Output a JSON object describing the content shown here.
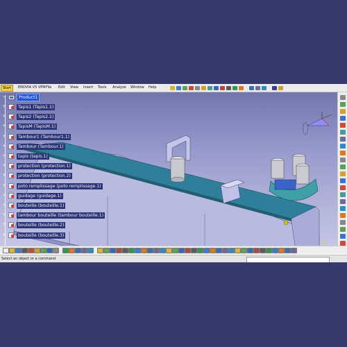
{
  "menubar": {
    "start_label": "Start",
    "items": [
      "ENOVIA V5 VPM",
      "File",
      "Edit",
      "View",
      "Insert",
      "Tools",
      "Analyze",
      "Window",
      "Help"
    ]
  },
  "tree": {
    "root": "Product1",
    "items": [
      "Tapis1 (Tapis1.1)",
      "Tapis2 (Tapis2.1)",
      "TapisM (TapisM.1)",
      "Tambour1 (Tambour1.1)",
      "Tambour (Tambour.1)",
      "tapis (tapis.1)",
      "protection (protection.1)",
      "protection (protection.2)",
      "poto remplissage (poto remplissage.1)",
      "guidage (guidage.1)",
      "bouteille (bouteille.1)",
      "tambour bouteille (tambour bouteille.1)",
      "bouteille (bouteille.2)",
      "bouteille (bouteille.3)"
    ]
  },
  "status": {
    "message": "Select an object or a command",
    "command_value": ""
  },
  "colors": {
    "background": "#353a6b",
    "tree_label_bg": "#2b3476",
    "tree_selected_bg": "#1d52e8",
    "belt": "#2f7f9a",
    "frame": "#b9bbe0"
  },
  "icons": {
    "toolbar_top": "standard-toolbar-icons",
    "toolbar_right": "product-structure-icons",
    "toolbar_bottom": "view-toolbar-icons",
    "compass": "3d-compass-icon"
  }
}
